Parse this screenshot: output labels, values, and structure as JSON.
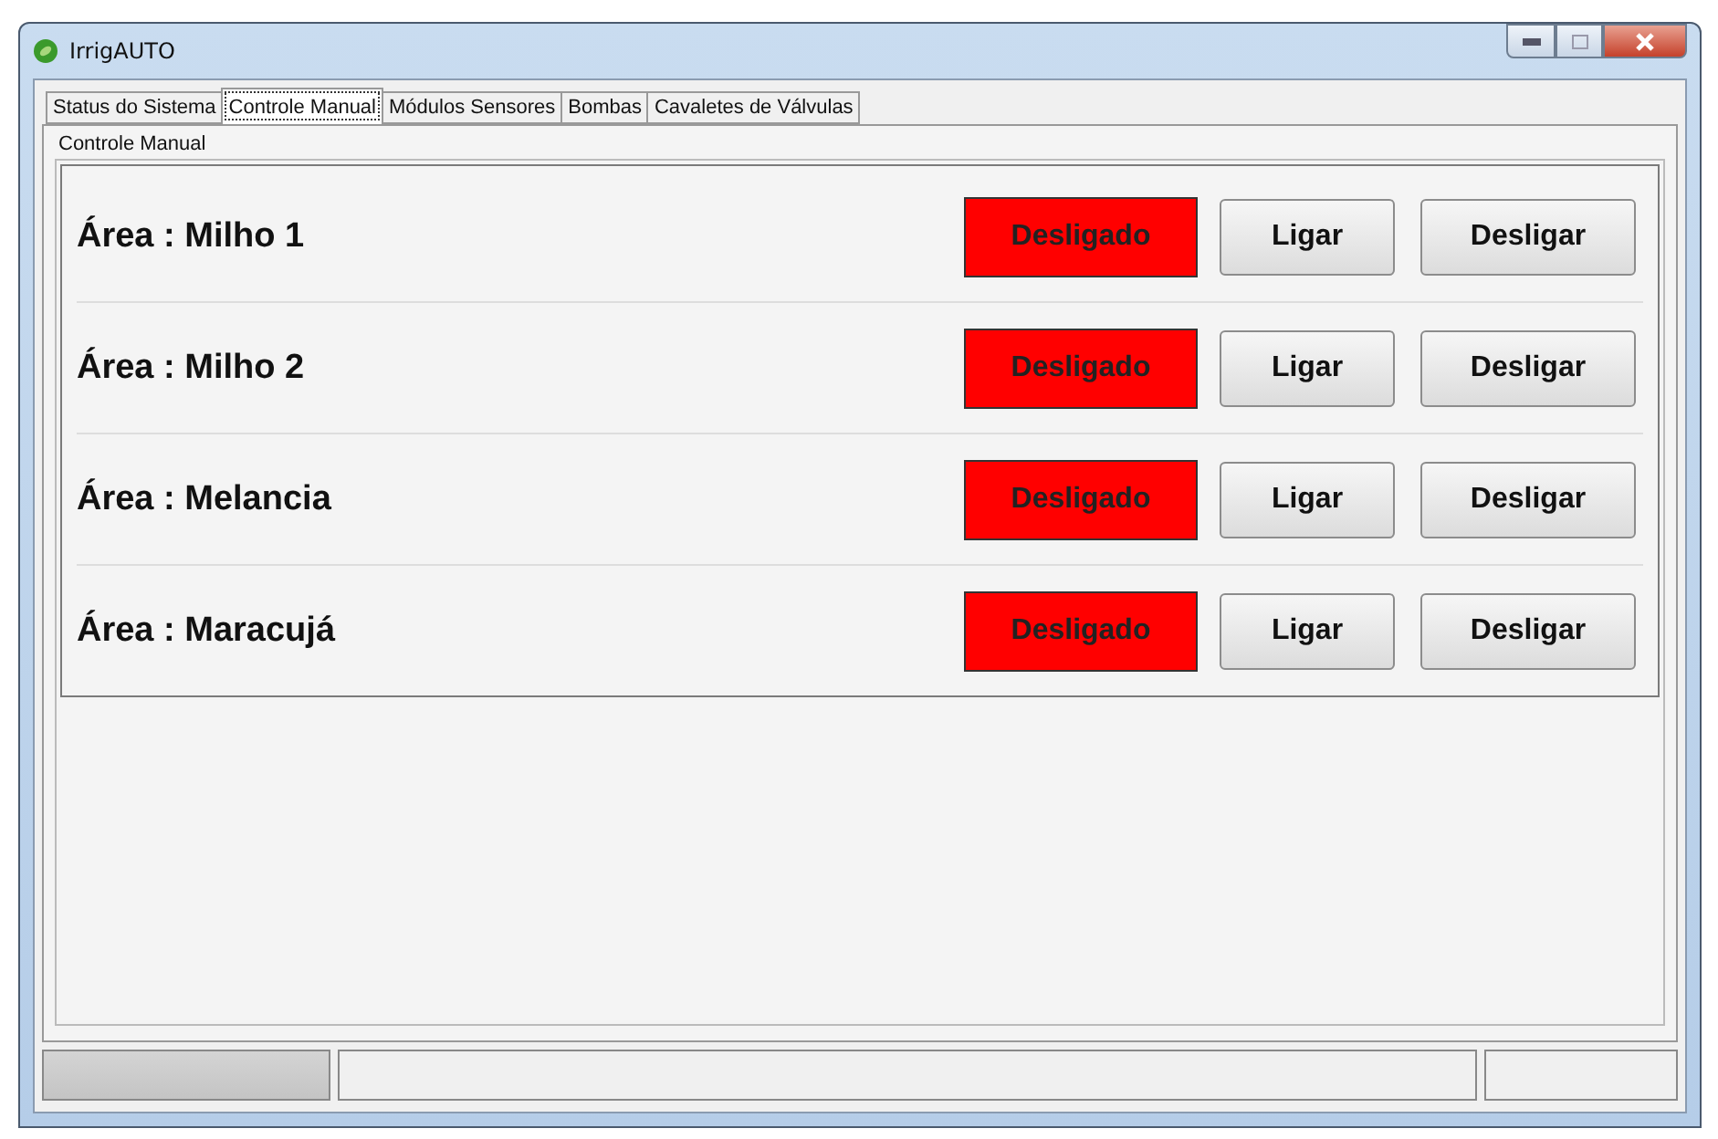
{
  "window": {
    "title": "IrrigAUTO"
  },
  "tabs": [
    {
      "label": "Status do Sistema",
      "selected": false
    },
    {
      "label": "Controle Manual",
      "selected": true
    },
    {
      "label": "Módulos Sensores",
      "selected": false
    },
    {
      "label": "Bombas",
      "selected": false
    },
    {
      "label": "Cavaletes de Válvulas",
      "selected": false
    }
  ],
  "group": {
    "title": "Controle Manual"
  },
  "areas": [
    {
      "name": "Área : Milho 1",
      "status": "Desligado",
      "on": false,
      "on_button": "Ligar",
      "off_button": "Desligar"
    },
    {
      "name": "Área : Milho 2",
      "status": "Desligado",
      "on": false,
      "on_button": "Ligar",
      "off_button": "Desligar"
    },
    {
      "name": "Área : Melancia",
      "status": "Desligado",
      "on": false,
      "on_button": "Ligar",
      "off_button": "Desligar"
    },
    {
      "name": "Área : Maracujá",
      "status": "Desligado",
      "on": false,
      "on_button": "Ligar",
      "off_button": "Desligar"
    }
  ]
}
